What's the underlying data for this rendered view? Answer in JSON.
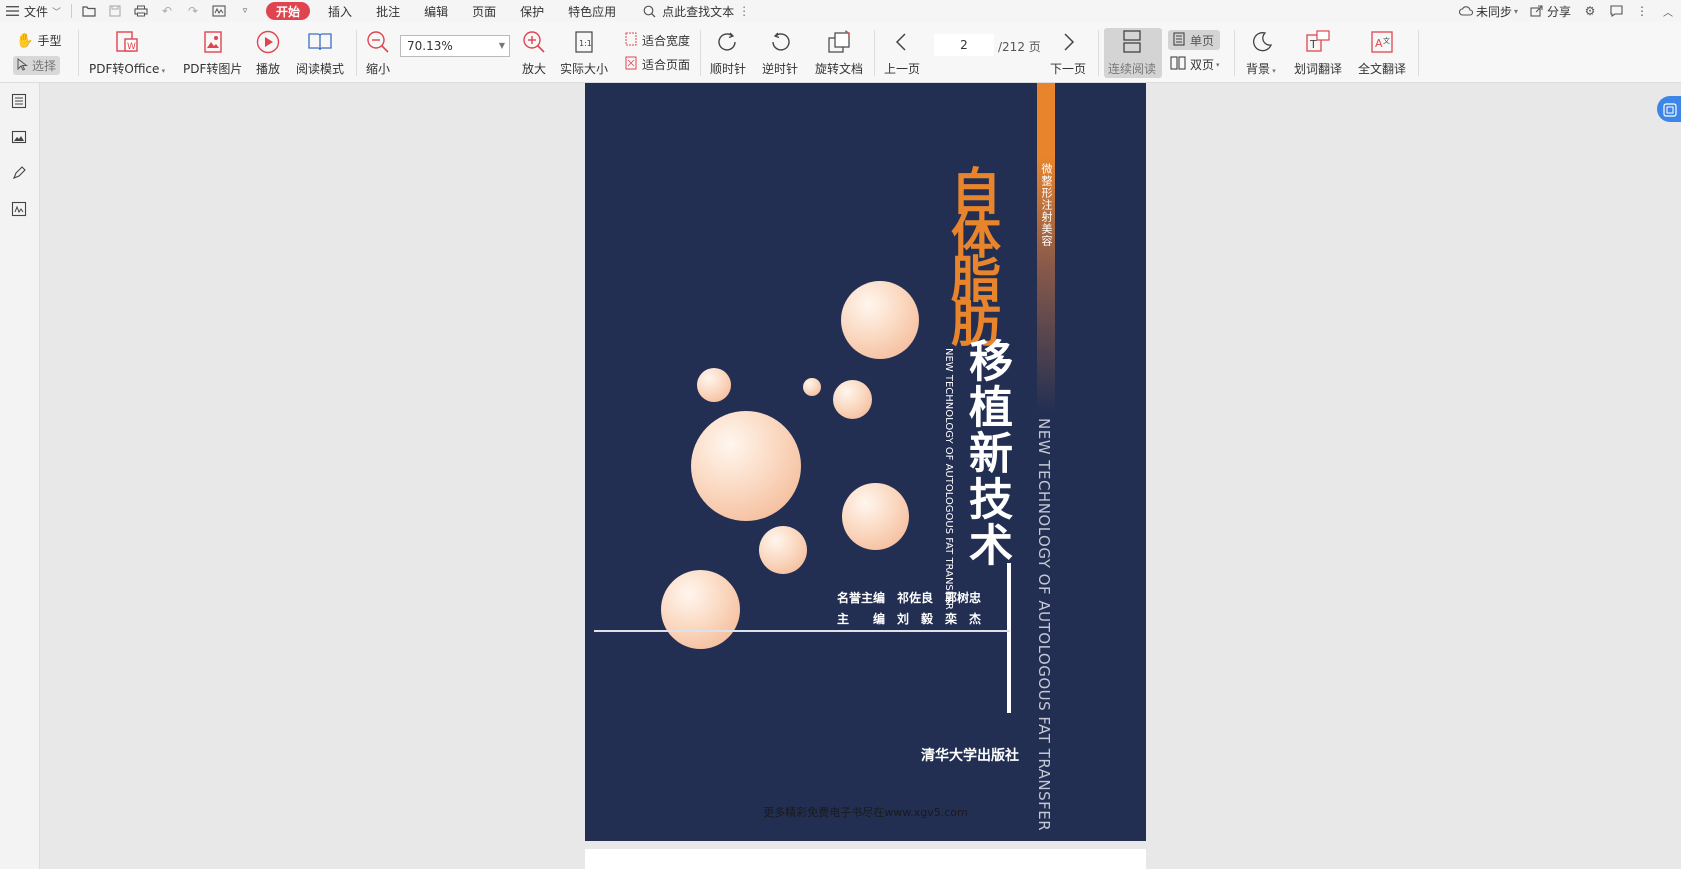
{
  "menubar": {
    "file": "文件",
    "tabs": [
      "开始",
      "插入",
      "批注",
      "编辑",
      "页面",
      "保护",
      "特色应用"
    ],
    "search_placeholder": "点此查找文本",
    "sync": "未同步",
    "share": "分享"
  },
  "toolbar": {
    "hand": "手型",
    "select": "选择",
    "pdf_to_office": "PDF转Office",
    "pdf_to_image": "PDF转图片",
    "play": "播放",
    "read_mode": "阅读模式",
    "zoom_out": "缩小",
    "zoom_value": "70.13%",
    "zoom_in": "放大",
    "actual_size": "实际大小",
    "fit_width": "适合宽度",
    "fit_page": "适合页面",
    "clockwise": "顺时针",
    "counter_clockwise": "逆时针",
    "rotate_doc": "旋转文档",
    "prev_page": "上一页",
    "page_current": "2",
    "page_total": "/212 页",
    "next_page": "下一页",
    "continuous": "连续阅读",
    "single_page": "单页",
    "double_page": "双页",
    "background": "背景",
    "word_translate": "划词翻译",
    "full_translate": "全文翻译"
  },
  "document": {
    "series_label": "微整形注射美容",
    "title_orange": "自体脂肪",
    "title_white": "移植新技术",
    "english_small": "NEW TECHNOLOGY OF AUTOLOGOUS FAT TRANSFER",
    "english_big": "NEW TECHNOLOGY OF AUTOLOGOUS FAT TRANSFER",
    "editors_line1": "名誉主编　祁佐良　郭树忠",
    "editors_line2": "主　　编　刘　毅　栾　杰",
    "publisher": "清华大学出版社",
    "footer": "更多精彩免费电子书尽在www.xgv5.com"
  },
  "colors": {
    "accent_red": "#e0454f",
    "cover_navy": "#222f53",
    "cover_orange": "#e8852c"
  }
}
